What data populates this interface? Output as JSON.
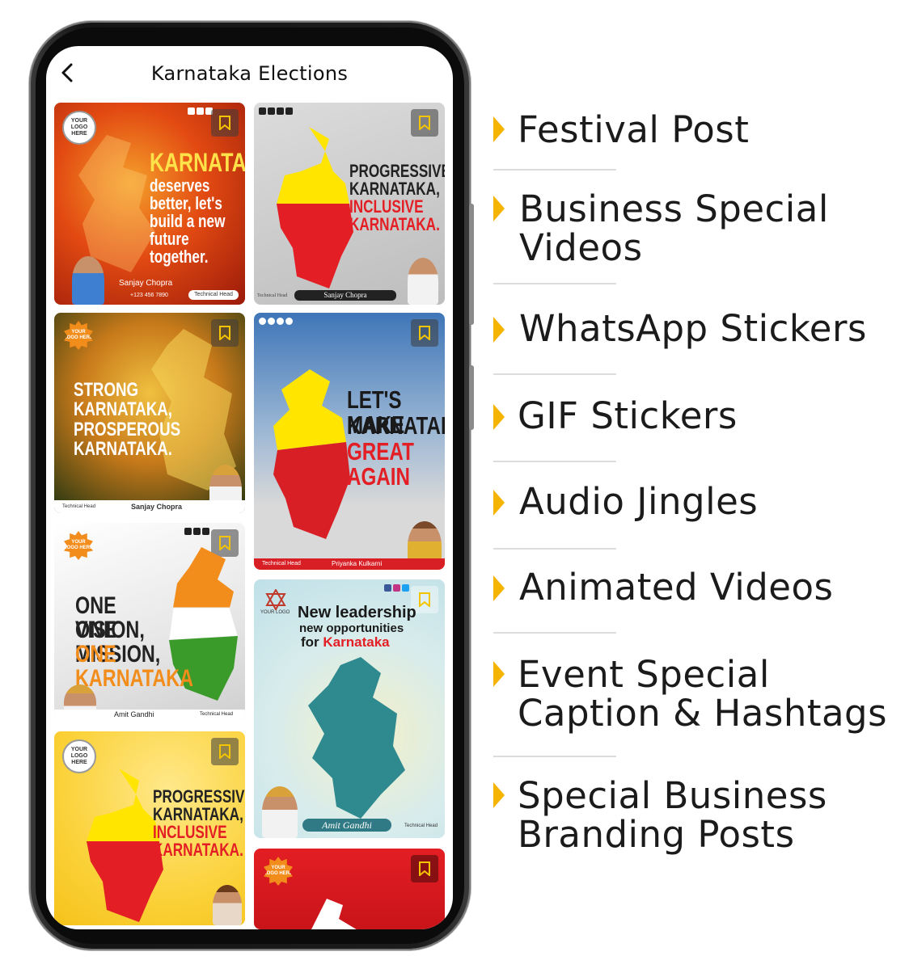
{
  "app": {
    "title": "Karnataka Elections"
  },
  "cards": {
    "c1": {
      "headline_top": "KARNATAKA",
      "headline_rest": "deserves better, let's build a new future together.",
      "name": "Sanjay Chopra",
      "role": "Technical Head",
      "phone": "+123 456 7890",
      "logo": "YOUR LOGO HERE"
    },
    "c2": {
      "headline_1": "PROGRESSIVE",
      "headline_2": "KARNATAKA,",
      "headline_3": "INCLUSIVE",
      "headline_4": "KARNATAKA.",
      "name": "Sanjay Chopra",
      "role": "Technical Head"
    },
    "c3": {
      "headline": "STRONG KARNATAKA, PROSPEROUS KARNATAKA.",
      "name": "Sanjay Chopra",
      "role": "Technical Head",
      "logo": "YOUR LOGO HERE"
    },
    "c4": {
      "headline_1": "LET'S MAKE",
      "headline_2": "KARNATAKA",
      "headline_3": "GREAT AGAIN",
      "name": "Priyanka Kulkarni",
      "role": "Technical Head"
    },
    "c5": {
      "headline_1": "ONE VISION,",
      "headline_2": "ONE MISSION,",
      "headline_3": "ONE KARNATAKA",
      "name": "Amit Gandhi",
      "role": "Technical Head",
      "logo": "YOUR LOGO HERE"
    },
    "c6": {
      "headline_1": "New leadership",
      "headline_2": "new opportunities",
      "headline_3a": "for ",
      "headline_3b": "Karnataka",
      "name": "Amit Gandhi",
      "role": "Technical Head",
      "logo": "YOUR LOGO"
    },
    "c7": {
      "headline_1": "PROGRESSIVE",
      "headline_2": "KARNATAKA,",
      "headline_3": "INCLUSIVE",
      "headline_4": "KARNATAKA.",
      "logo": "YOUR LOGO HERE"
    },
    "c8": {
      "logo": "YOUR LOGO HERE"
    }
  },
  "features": [
    {
      "lines": [
        "Festival Post"
      ]
    },
    {
      "lines": [
        "Business Special",
        "Videos"
      ]
    },
    {
      "lines": [
        "WhatsApp Stickers"
      ]
    },
    {
      "lines": [
        "GIF Stickers"
      ]
    },
    {
      "lines": [
        "Audio Jingles"
      ]
    },
    {
      "lines": [
        "Animated Videos"
      ]
    },
    {
      "lines": [
        "Event Special",
        "Caption & Hashtags"
      ]
    },
    {
      "lines": [
        "Special Business",
        "Branding Posts"
      ]
    }
  ],
  "colors": {
    "accent": "#f5b400",
    "red": "#e31e24",
    "yellow": "#ffe500",
    "orange": "#f28c1a",
    "green": "#3a9a2a"
  },
  "icons": {
    "back": "chevron-left-icon",
    "bookmark": "bookmark-icon",
    "feature_marker": "triangle-right-icon"
  }
}
